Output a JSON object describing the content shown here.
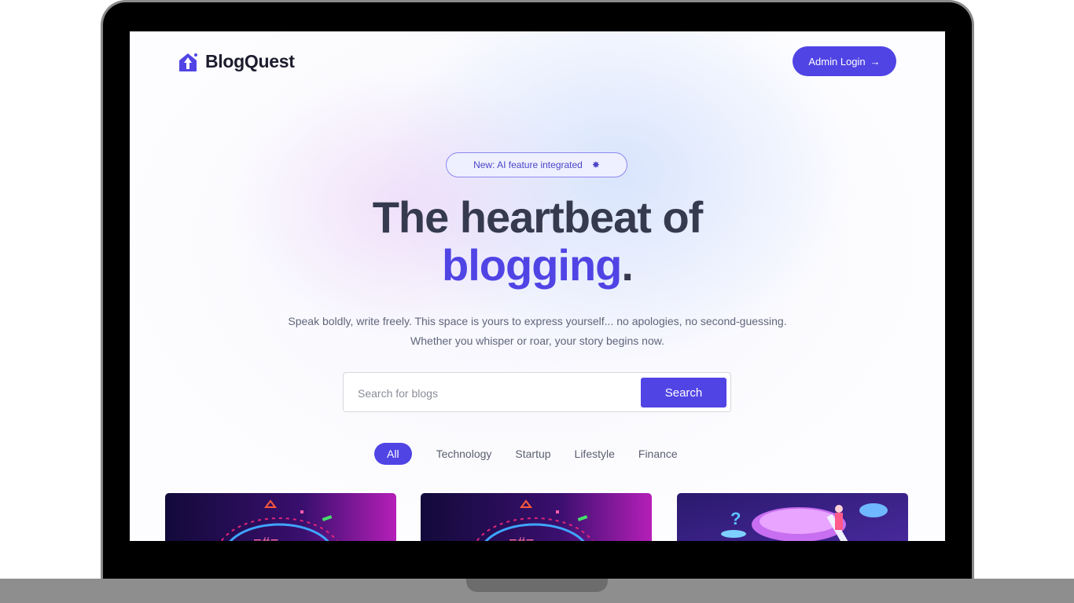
{
  "brand": {
    "name": "BlogQuest",
    "icon": "rocket-house-icon"
  },
  "header": {
    "admin_label": "Admin Login",
    "admin_arrow": "→"
  },
  "hero": {
    "badge_text": "New: AI feature integrated",
    "badge_icon": "sparkle-icon",
    "headline_line1": "The heartbeat of",
    "headline_accent": "blogging",
    "headline_period": ".",
    "subtext": "Speak boldly, write freely. This space is yours to express yourself... no apologies, no second-guessing. Whether you whisper or roar, your story begins now."
  },
  "search": {
    "placeholder": "Search for blogs",
    "button_label": "Search"
  },
  "categories": [
    "All",
    "Technology",
    "Startup",
    "Lifestyle",
    "Finance"
  ],
  "active_category": "All",
  "colors": {
    "accent": "#5044e5",
    "heading": "#353a4f",
    "body": "#60657a"
  }
}
